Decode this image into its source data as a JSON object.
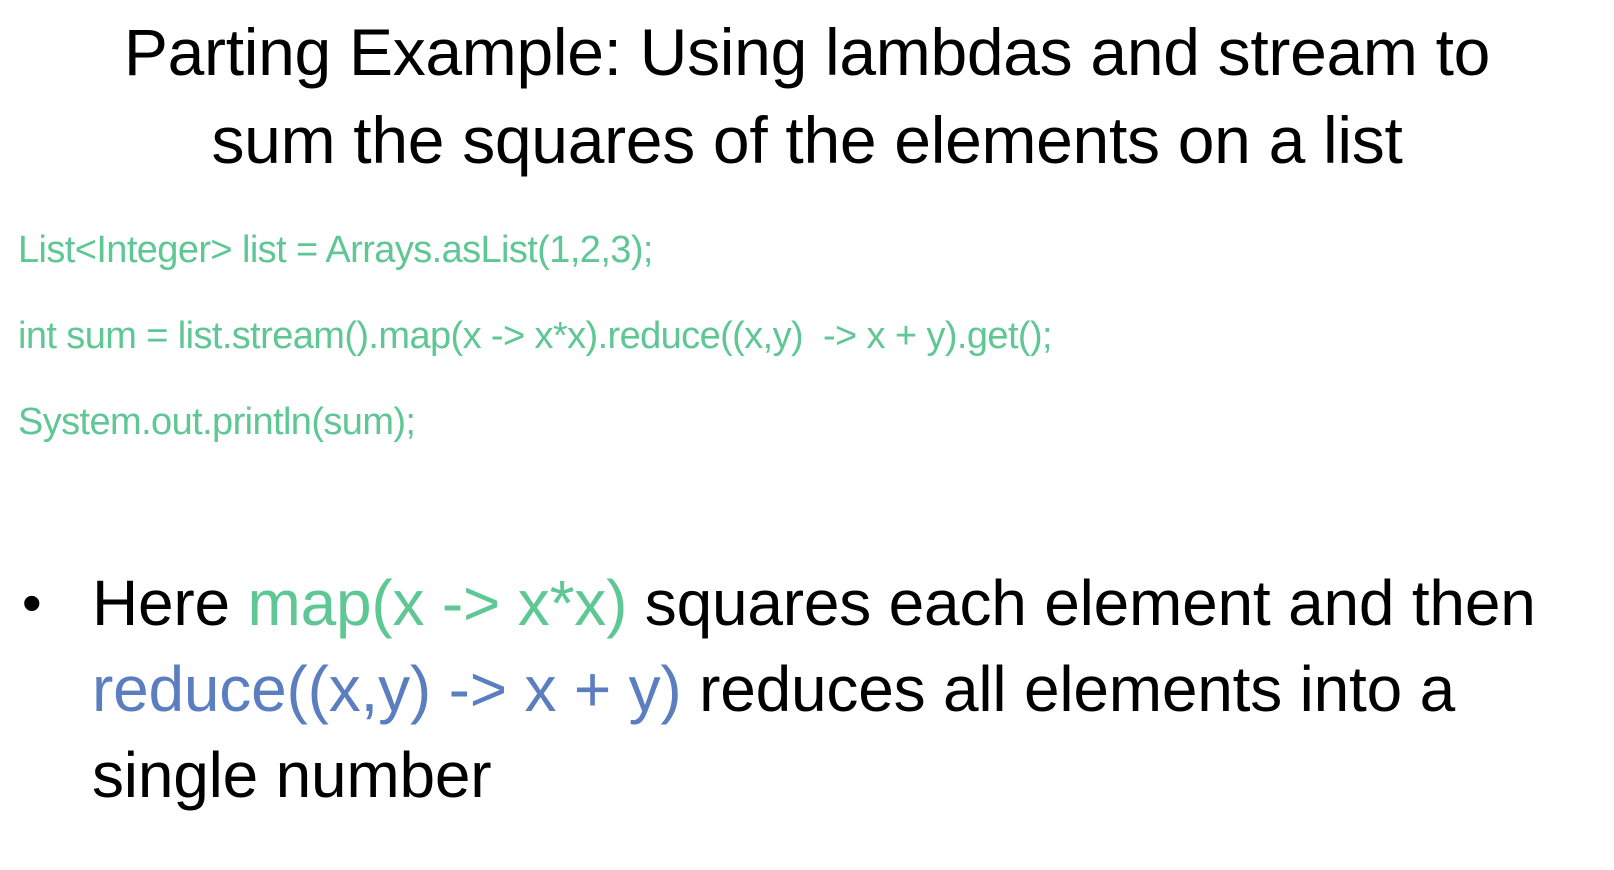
{
  "title": {
    "line1": "Parting Example: Using lambdas and stream to",
    "line2": "sum the squares of the elements on a list"
  },
  "code": {
    "lines": [
      "List<Integer> list = Arrays.asList(1,2,3);",
      "int sum = list.stream().map(x -> x*x).reduce((x,y)  -> x + y).get();",
      "System.out.println(sum);"
    ]
  },
  "bullet": {
    "marker": "•",
    "segments": {
      "part1": "Here ",
      "map_expr": "map(x -> x*x)",
      "part2": " squares each element and then ",
      "reduce_expr": "reduce((x,y) -> x + y)",
      "part3": " reduces all elements into a single number"
    }
  },
  "colors": {
    "code_green": "#5ec793",
    "reduce_blue": "#5b7ec0",
    "text": "#000000",
    "background": "#ffffff"
  }
}
